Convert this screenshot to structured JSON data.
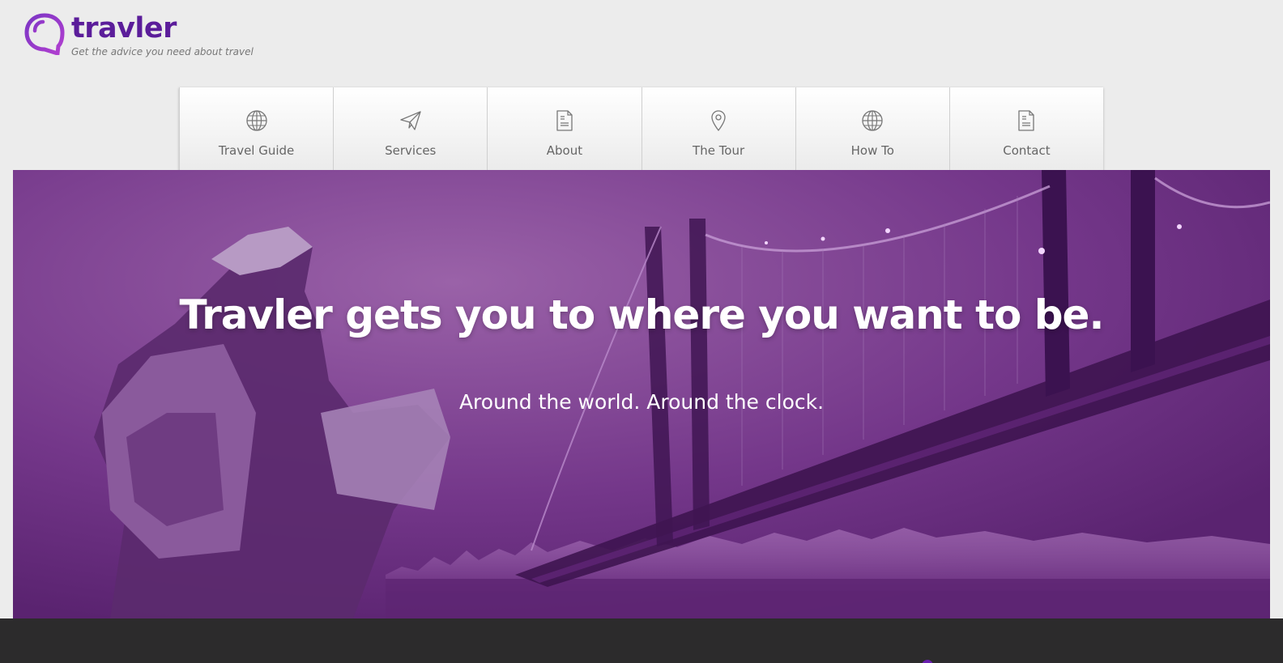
{
  "brand": {
    "name": "travler",
    "tagline": "Get the advice you need about travel",
    "accent_color": "#5b17a0",
    "logo_icon": "speech-bubble-icon"
  },
  "nav": {
    "items": [
      {
        "label": "Travel Guide",
        "icon": "globe-icon"
      },
      {
        "label": "Services",
        "icon": "paper-plane-icon"
      },
      {
        "label": "About",
        "icon": "document-icon"
      },
      {
        "label": "The Tour",
        "icon": "map-pin-icon"
      },
      {
        "label": "How To",
        "icon": "globe-icon"
      },
      {
        "label": "Contact",
        "icon": "document-icon"
      }
    ]
  },
  "hero": {
    "title": "Travler gets you to where you want to be.",
    "subtitle": "Around the world. Around the clock.",
    "overlay_color": "#6e3282"
  },
  "footer": {
    "background_color": "#2c2b2c"
  }
}
